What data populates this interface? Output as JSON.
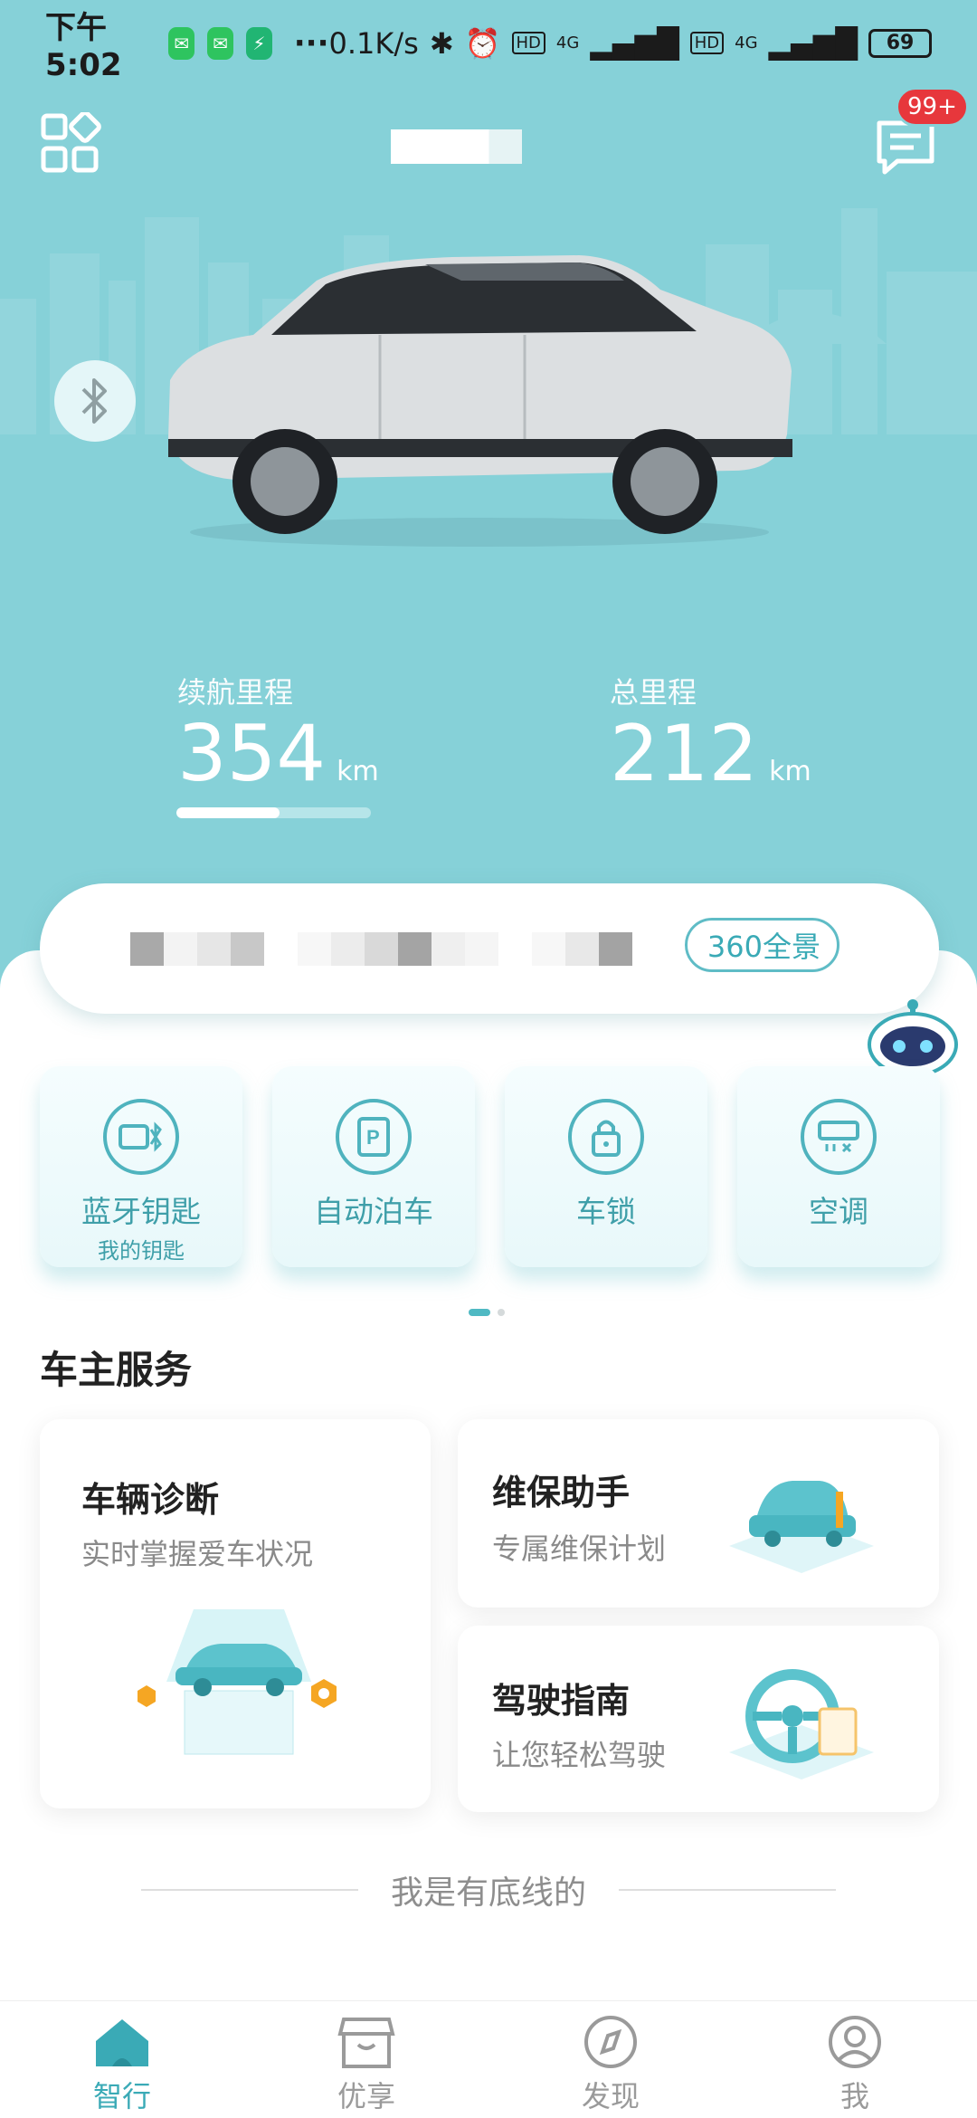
{
  "status_bar": {
    "time": "下午5:02",
    "more": "···",
    "net_speed": "0.1K/s",
    "hd1": "HD",
    "hd2": "HD",
    "net1": "4G",
    "net2": "4G",
    "battery": "69"
  },
  "header": {
    "badge": "99+"
  },
  "stats": {
    "range_label": "续航里程",
    "range_value": "354",
    "range_unit": "km",
    "range_fraction": 0.53,
    "odometer_label": "总里程",
    "odometer_value": "212",
    "odometer_unit": "km"
  },
  "panorama_label": "360全景",
  "quick_actions": [
    {
      "label": "蓝牙钥匙",
      "sub": "我的钥匙"
    },
    {
      "label": "自动泊车"
    },
    {
      "label": "车锁"
    },
    {
      "label": "空调"
    }
  ],
  "services": {
    "title": "车主服务",
    "diagnosis": {
      "title": "车辆诊断",
      "sub": "实时掌握爱车状况"
    },
    "maintenance": {
      "title": "维保助手",
      "sub": "专属维保计划"
    },
    "guide": {
      "title": "驾驶指南",
      "sub": "让您轻松驾驶"
    }
  },
  "footer_note": "我是有底线的",
  "tabs": [
    {
      "label": "智行",
      "icon": "home-icon"
    },
    {
      "label": "优享",
      "icon": "store-icon"
    },
    {
      "label": "发现",
      "icon": "compass-icon"
    },
    {
      "label": "我",
      "icon": "user-icon"
    }
  ],
  "colors": {
    "hero_bg": "#86d1d8",
    "accent": "#3aaab6",
    "badge": "#e7373c"
  }
}
